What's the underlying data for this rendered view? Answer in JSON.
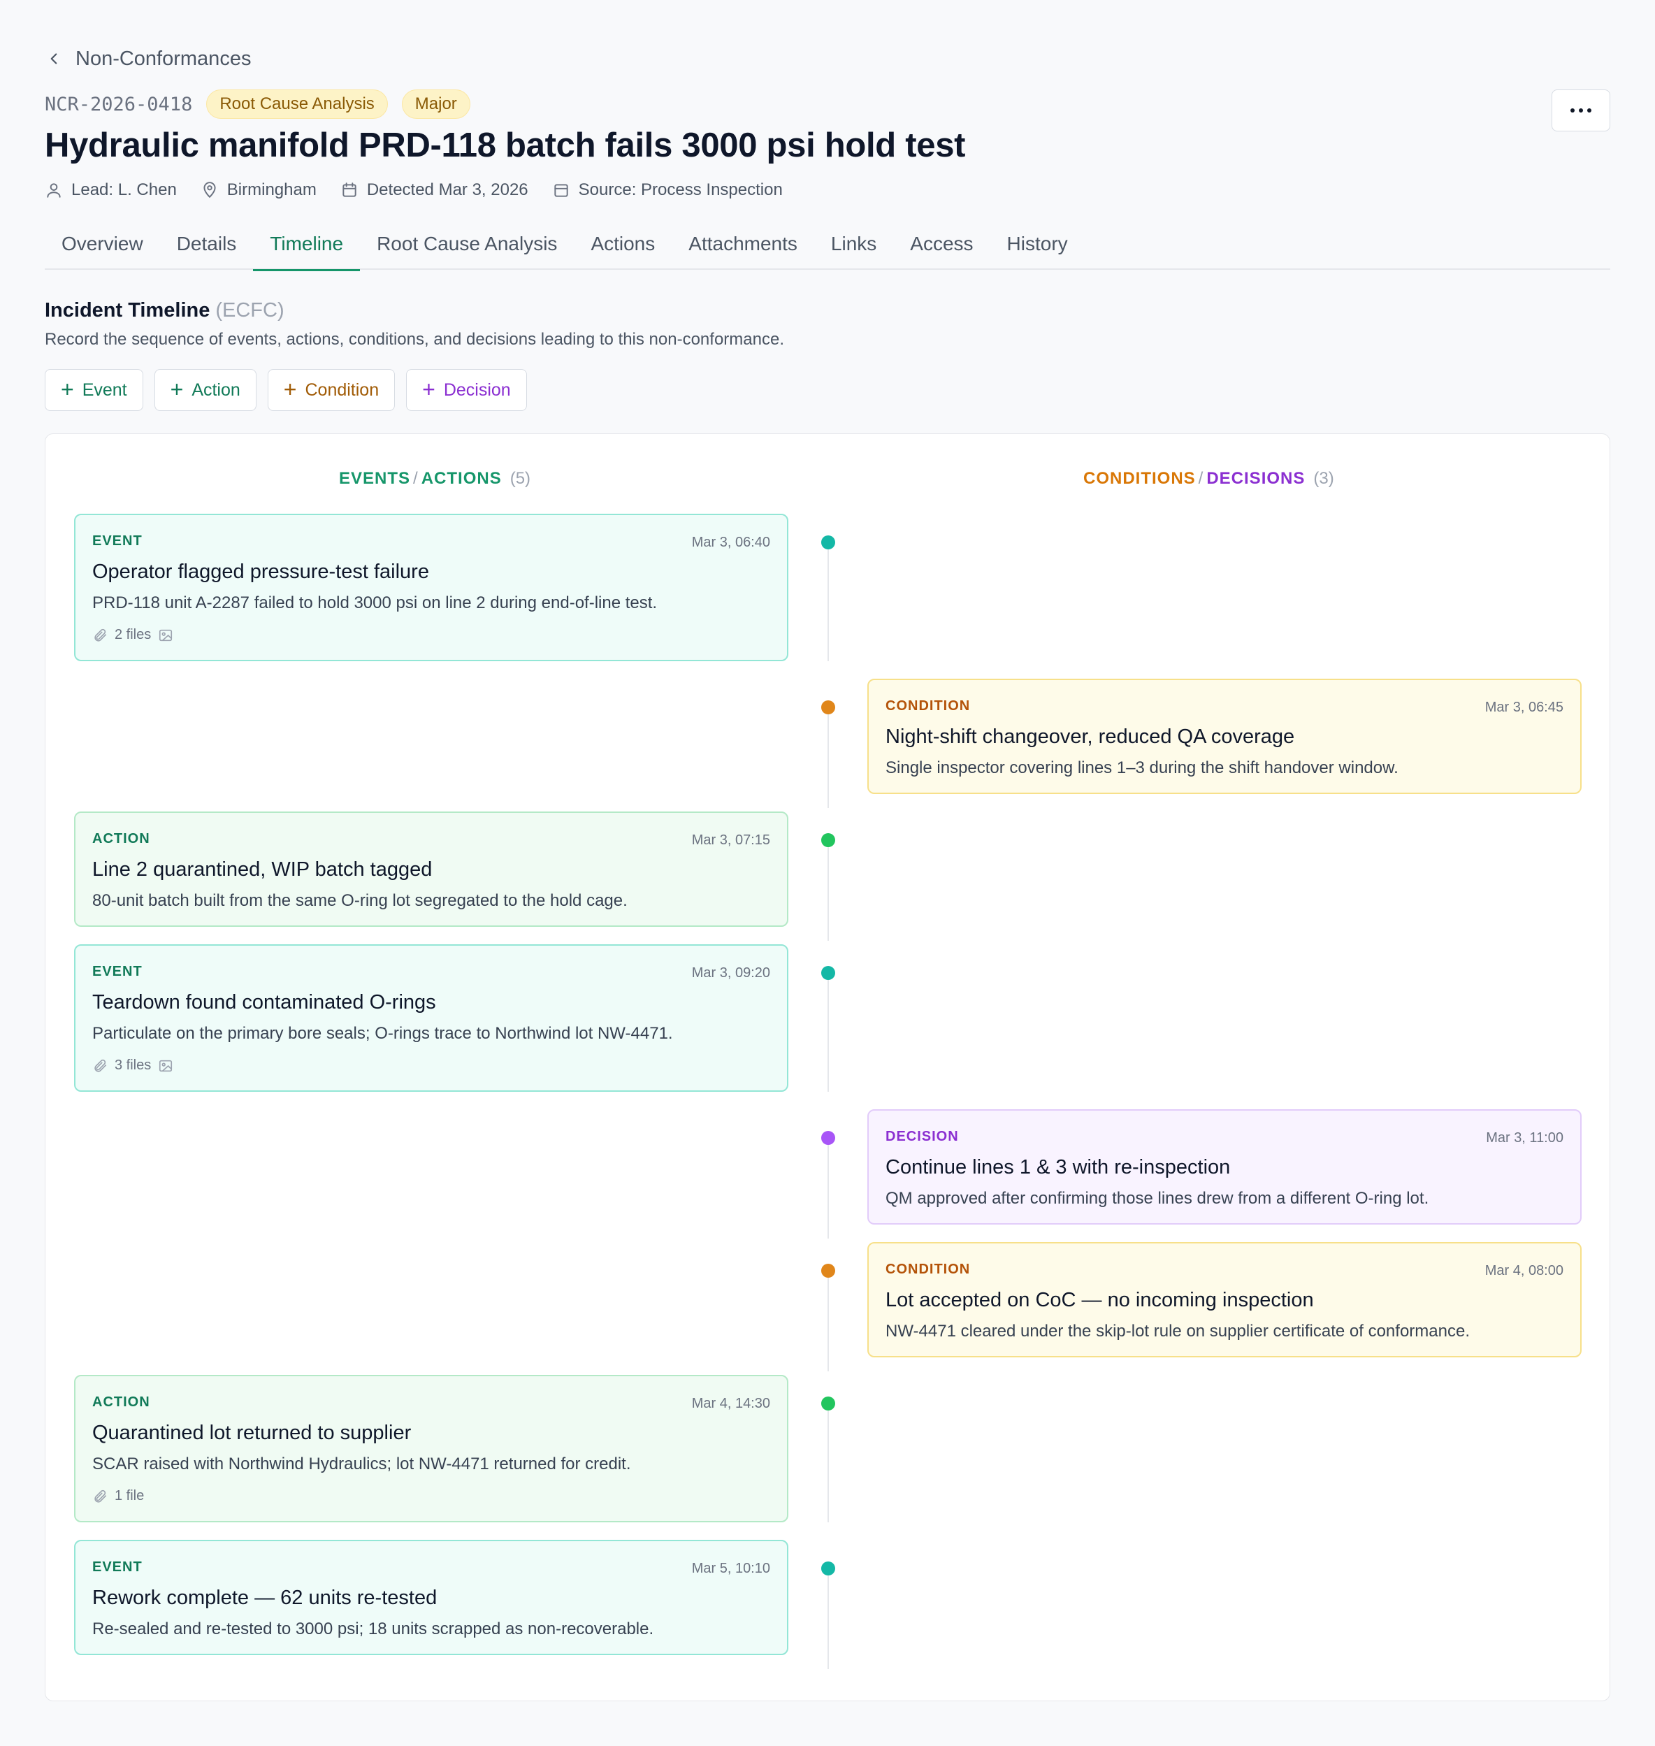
{
  "breadcrumb": {
    "label": "Non-Conformances"
  },
  "record": {
    "id": "NCR-2026-0418",
    "status": "Root Cause Analysis",
    "severity": "Major",
    "title": "Hydraulic manifold PRD-118 batch fails 3000 psi hold test",
    "lead": "Lead: L. Chen",
    "location": "Birmingham",
    "detected": "Detected Mar 3, 2026",
    "source": "Source: Process Inspection"
  },
  "tabs": [
    "Overview",
    "Details",
    "Timeline",
    "Root Cause Analysis",
    "Actions",
    "Attachments",
    "Links",
    "Access",
    "History"
  ],
  "active_tab": "Timeline",
  "section": {
    "title": "Incident Timeline",
    "subtitle": "(ECFC)",
    "description": "Record the sequence of events, actions, conditions, and decisions leading to this non-conformance."
  },
  "add_buttons": {
    "event": "Event",
    "action": "Action",
    "condition": "Condition",
    "decision": "Decision"
  },
  "columns": {
    "left": {
      "part1": "EVENTS",
      "sep": "/",
      "part2": "ACTIONS",
      "count": "(5)"
    },
    "right": {
      "part1": "CONDITIONS",
      "sep": "/",
      "part2": "DECISIONS",
      "count": "(3)"
    }
  },
  "entries": [
    {
      "kind": "EVENT",
      "time": "Mar 3, 06:40",
      "title": "Operator flagged pressure-test failure",
      "description": "PRD-118 unit A-2287 failed to hold 3000 psi on line 2 during end-of-line test.",
      "files": "2 files"
    },
    {
      "kind": "CONDITION",
      "time": "Mar 3, 06:45",
      "title": "Night-shift changeover, reduced QA coverage",
      "description": "Single inspector covering lines 1–3 during the shift handover window."
    },
    {
      "kind": "ACTION",
      "time": "Mar 3, 07:15",
      "title": "Line 2 quarantined, WIP batch tagged",
      "description": "80-unit batch built from the same O-ring lot segregated to the hold cage."
    },
    {
      "kind": "EVENT",
      "time": "Mar 3, 09:20",
      "title": "Teardown found contaminated O-rings",
      "description": "Particulate on the primary bore seals; O-rings trace to Northwind lot NW-4471.",
      "files": "3 files"
    },
    {
      "kind": "DECISION",
      "time": "Mar 3, 11:00",
      "title": "Continue lines 1 & 3 with re-inspection",
      "description": "QM approved after confirming those lines drew from a different O-ring lot."
    },
    {
      "kind": "CONDITION",
      "time": "Mar 4, 08:00",
      "title": "Lot accepted on CoC — no incoming inspection",
      "description": "NW-4471 cleared under the skip-lot rule on supplier certificate of conformance."
    },
    {
      "kind": "ACTION",
      "time": "Mar 4, 14:30",
      "title": "Quarantined lot returned to supplier",
      "description": "SCAR raised with Northwind Hydraulics; lot NW-4471 returned for credit.",
      "files": "1 file"
    },
    {
      "kind": "EVENT",
      "time": "Mar 5, 10:10",
      "title": "Rework complete — 62 units re-tested",
      "description": "Re-sealed and re-tested to 3000 psi; 18 units scrapped as non-recoverable."
    }
  ],
  "colors": {
    "accent": "#16966a",
    "event": "#14b8a6",
    "action": "#22c55e",
    "condition": "#e0861a",
    "decision": "#a855f7"
  }
}
